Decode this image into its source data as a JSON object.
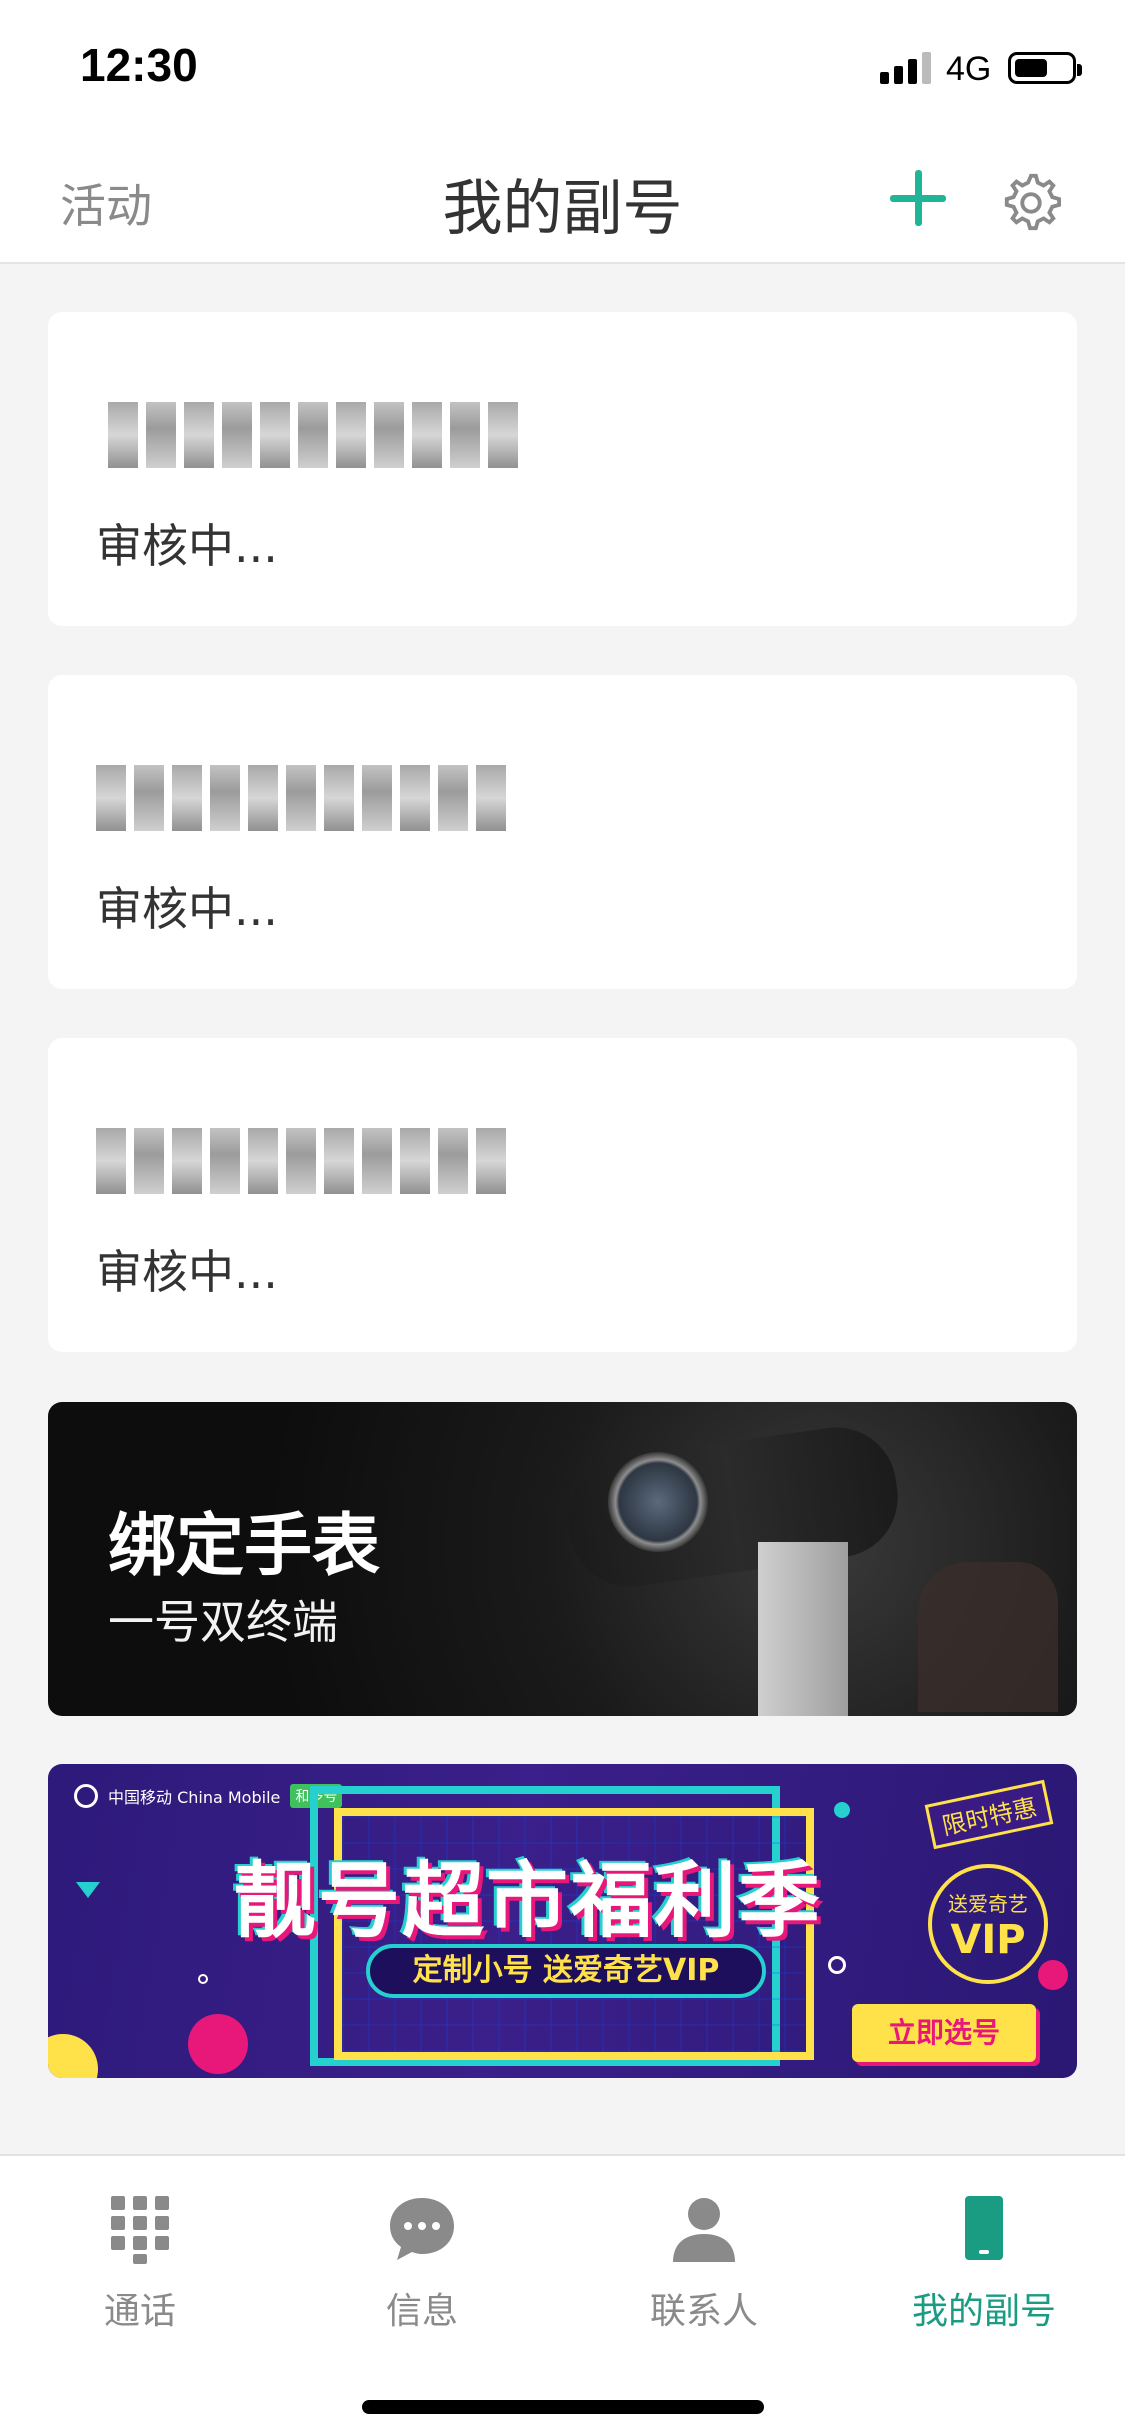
{
  "status_bar": {
    "time": "12:30",
    "network": "4G"
  },
  "header": {
    "left_label": "活动",
    "title": "我的副号",
    "add_icon": "plus-icon",
    "settings_icon": "gear-icon",
    "accent_color": "#1fb596"
  },
  "numbers": [
    {
      "status": "审核中..."
    },
    {
      "status": "审核中..."
    },
    {
      "status": "审核中..."
    }
  ],
  "watch_banner": {
    "title": "绑定手表",
    "subtitle": "一号双终端"
  },
  "promo_banner": {
    "brand": "中国移动 China Mobile",
    "brand_badge": "和多号",
    "title": "靓号超市福利季",
    "pill_text": "定制小号 送爱奇艺VIP",
    "tag_text": "限时特惠",
    "vip_line1": "送爱奇艺",
    "vip_line2": "VIP",
    "button_label": "立即选号"
  },
  "tab_bar": {
    "tabs": [
      {
        "label": "通话",
        "icon": "dialpad-icon",
        "active": false
      },
      {
        "label": "信息",
        "icon": "message-icon",
        "active": false
      },
      {
        "label": "联系人",
        "icon": "contact-icon",
        "active": false
      },
      {
        "label": "我的副号",
        "icon": "phone-icon",
        "active": true
      }
    ],
    "active_color": "#1a9c83",
    "inactive_color": "#8a8a8a"
  }
}
